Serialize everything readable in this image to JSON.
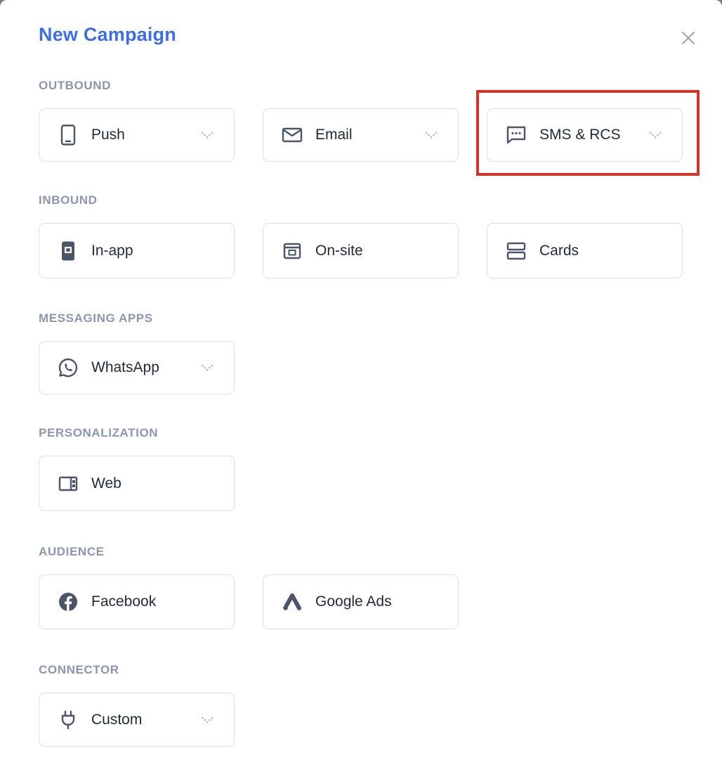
{
  "dialog": {
    "title": "New Campaign",
    "close_icon": "close-icon"
  },
  "sections": {
    "outbound": {
      "label": "OUTBOUND",
      "push": {
        "label": "Push",
        "icon": "mobile-phone-icon",
        "has_dropdown": true
      },
      "email": {
        "label": "Email",
        "icon": "envelope-icon",
        "has_dropdown": true
      },
      "sms": {
        "label": "SMS & RCS",
        "icon": "chat-bubble-icon",
        "has_dropdown": true,
        "highlighted": true
      }
    },
    "inbound": {
      "label": "INBOUND",
      "inapp": {
        "label": "In-app",
        "icon": "in-app-icon"
      },
      "onsite": {
        "label": "On-site",
        "icon": "browser-window-icon"
      },
      "cards": {
        "label": "Cards",
        "icon": "stacked-cards-icon"
      }
    },
    "messaging_apps": {
      "label": "MESSAGING APPS",
      "whatsapp": {
        "label": "WhatsApp",
        "icon": "whatsapp-icon",
        "has_dropdown": true
      }
    },
    "personalization": {
      "label": "PERSONALIZATION",
      "web": {
        "label": "Web",
        "icon": "web-layout-icon"
      }
    },
    "audience": {
      "label": "AUDIENCE",
      "facebook": {
        "label": "Facebook",
        "icon": "facebook-icon"
      },
      "google_ads": {
        "label": "Google Ads",
        "icon": "google-ads-icon"
      }
    },
    "connector": {
      "label": "CONNECTOR",
      "custom": {
        "label": "Custom",
        "icon": "plug-icon",
        "has_dropdown": true
      }
    }
  },
  "colors": {
    "title": "#3d6ee8",
    "section_label": "#8a97ad",
    "icon": "#4a5568",
    "card_border": "#dcdfe5",
    "highlight": "#d6322a",
    "chevron": "#a8b4e0"
  }
}
